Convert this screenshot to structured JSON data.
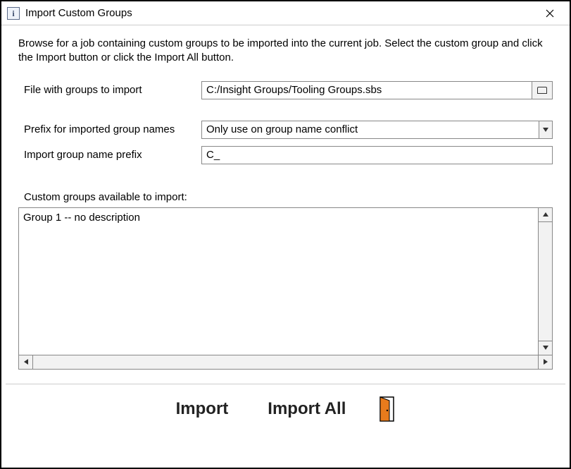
{
  "window": {
    "title": "Import Custom Groups",
    "icon_letter": "i"
  },
  "instructions": "Browse for a job containing custom groups to be imported into the current job. Select the custom group and click the Import button or click the Import All button.",
  "fields": {
    "file_label": "File with groups to import",
    "file_value": "C:/Insight Groups/Tooling Groups.sbs",
    "prefix_mode_label": "Prefix for imported group names",
    "prefix_mode_value": "Only use on group name conflict",
    "prefix_label": "Import group name prefix",
    "prefix_value": "C_"
  },
  "list": {
    "heading": "Custom groups available to import:",
    "items": [
      "Group 1  --  no description"
    ]
  },
  "buttons": {
    "import": "Import",
    "import_all": "Import All"
  }
}
